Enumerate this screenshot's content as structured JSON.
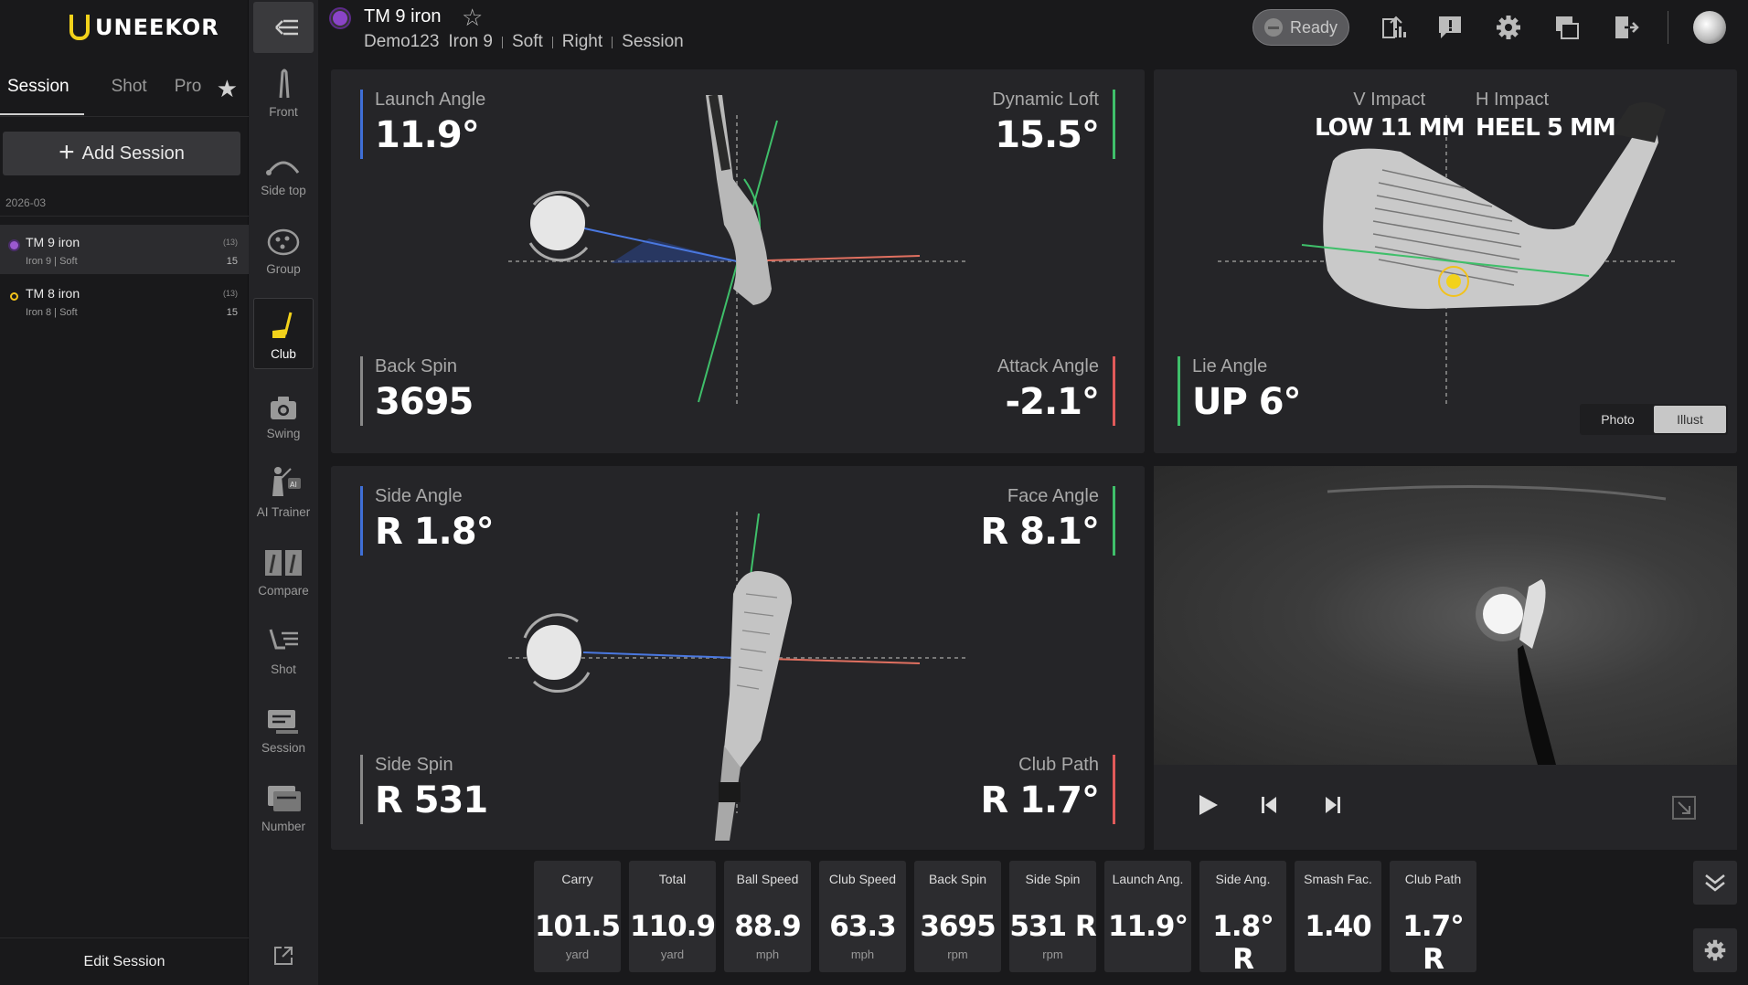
{
  "brand": "UNEEKOR",
  "left_tabs": [
    "Session",
    "Shot",
    "Pro"
  ],
  "add_session_label": "Add Session",
  "session_date": "2026-03",
  "sessions": [
    {
      "name": "TM 9 iron",
      "detail": "Iron 9 | Soft",
      "count_tag": "(13)",
      "shots": "15",
      "dot_color": "#9b59d0"
    },
    {
      "name": "TM 8 iron",
      "detail": "Iron 8 | Soft",
      "count_tag": "(13)",
      "shots": "15",
      "dot_color": "#f2c21b"
    }
  ],
  "edit_session_label": "Edit Session",
  "rail": [
    "Front",
    "Side top",
    "Group",
    "Club",
    "Swing",
    "AI Trainer",
    "Compare",
    "Shot",
    "Session",
    "Number"
  ],
  "header": {
    "title": "TM 9 iron",
    "sub": [
      "Demo123",
      "Iron 9",
      "Soft",
      "Right",
      "Session"
    ],
    "status": "Ready"
  },
  "club_side": {
    "launch_angle": {
      "label": "Launch Angle",
      "value": "11.9°"
    },
    "dynamic_loft": {
      "label": "Dynamic Loft",
      "value": "15.5°"
    },
    "back_spin": {
      "label": "Back Spin",
      "value": "3695"
    },
    "attack_angle": {
      "label": "Attack Angle",
      "value": "-2.1°"
    }
  },
  "impact": {
    "v_impact": {
      "label": "V Impact",
      "value": "LOW 11 MM"
    },
    "h_impact": {
      "label": "H Impact",
      "value": "HEEL 5 MM"
    },
    "lie_angle": {
      "label": "Lie Angle",
      "value": "UP 6°"
    },
    "view_options": [
      "Photo",
      "Illust"
    ],
    "selected_view": "Illust"
  },
  "club_top": {
    "side_angle": {
      "label": "Side Angle",
      "value": "R 1.8°"
    },
    "face_angle": {
      "label": "Face Angle",
      "value": "R 8.1°"
    },
    "side_spin": {
      "label": "Side Spin",
      "value": "R 531"
    },
    "club_path": {
      "label": "Club Path",
      "value": "R 1.7°"
    }
  },
  "stats": [
    {
      "label": "Carry",
      "value": "101.5",
      "unit": "yard"
    },
    {
      "label": "Total",
      "value": "110.9",
      "unit": "yard"
    },
    {
      "label": "Ball Speed",
      "value": "88.9",
      "unit": "mph"
    },
    {
      "label": "Club Speed",
      "value": "63.3",
      "unit": "mph"
    },
    {
      "label": "Back Spin",
      "value": "3695",
      "unit": "rpm"
    },
    {
      "label": "Side Spin",
      "value": "531 R",
      "unit": "rpm"
    },
    {
      "label": "Launch Ang.",
      "value": "11.9°",
      "unit": ""
    },
    {
      "label": "Side Ang.",
      "value": "1.8° R",
      "unit": ""
    },
    {
      "label": "Smash Fac.",
      "value": "1.40",
      "unit": ""
    },
    {
      "label": "Club Path",
      "value": "1.7° R",
      "unit": ""
    }
  ],
  "colors": {
    "blue": "#3f6fd6",
    "green": "#3fbf6a",
    "red": "#e05a5a",
    "accent": "#f2d21b"
  }
}
